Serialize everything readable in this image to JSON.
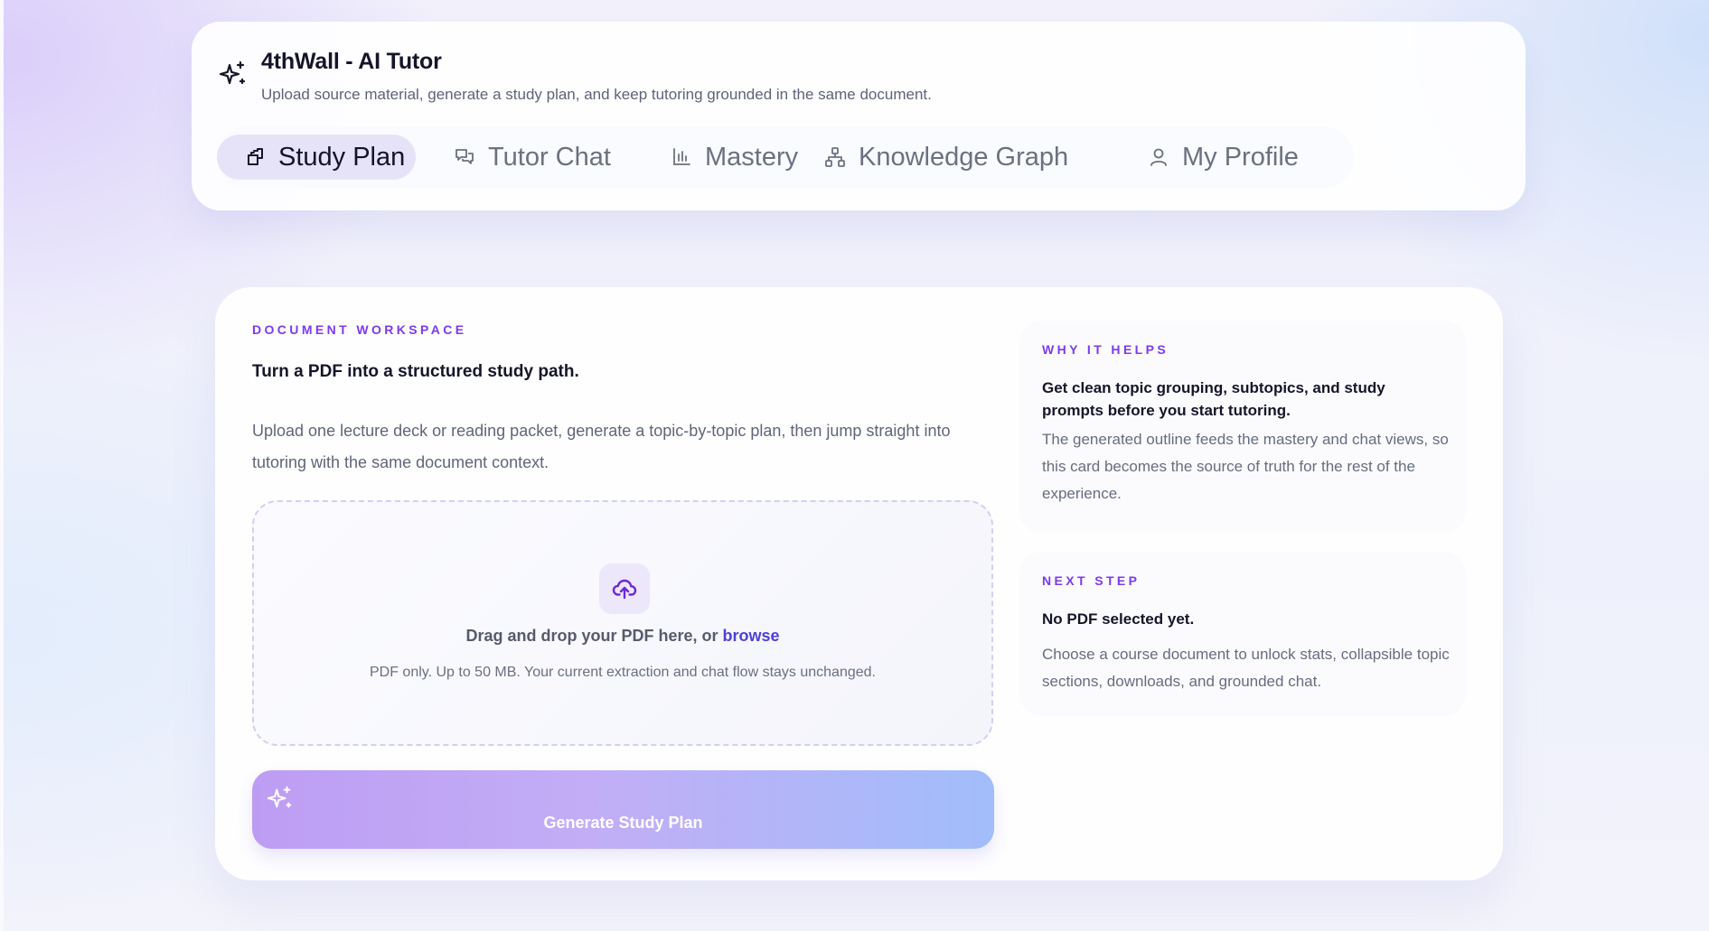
{
  "app": {
    "title": "4thWall - AI Tutor",
    "subtitle": "Upload source material, generate a study plan, and keep tutoring grounded in the same document."
  },
  "nav": {
    "active": "Study Plan",
    "tabs": [
      {
        "label": "Study Plan",
        "icon": "study-plan-icon"
      },
      {
        "label": "Tutor Chat",
        "icon": "chat-icon"
      },
      {
        "label": "Mastery",
        "icon": "bar-chart-icon"
      },
      {
        "label": "Knowledge Graph",
        "icon": "network-icon"
      },
      {
        "label": "My Profile",
        "icon": "user-icon"
      }
    ]
  },
  "workspace": {
    "eyebrow": "DOCUMENT WORKSPACE",
    "title": "Turn a PDF into a structured study path.",
    "description": "Upload one lecture deck or reading packet, generate a topic-by-topic plan, then jump straight into tutoring with the same document context.",
    "dropzone": {
      "prompt": "Drag and drop your PDF here, or ",
      "browse": "browse",
      "hint": "PDF only. Up to 50 MB. Your current extraction and chat flow stays unchanged."
    },
    "generate_label": "Generate Study Plan"
  },
  "why_card": {
    "eyebrow": "WHY IT HELPS",
    "title": "Get clean topic grouping, subtopics, and study prompts before you start tutoring.",
    "description": "The generated outline feeds the mastery and chat views, so this card becomes the source of truth for the rest of the experience."
  },
  "next_card": {
    "eyebrow": "NEXT STEP",
    "title": "No PDF selected yet.",
    "description": "Choose a course document to unlock stats, collapsible topic sections, downloads, and grounded chat."
  },
  "colors": {
    "accent": "#7c3aed",
    "link": "#4c3fd9",
    "active_tab_bg": "#e6e3f9",
    "button_gradient_start": "#bd9df3",
    "button_gradient_end": "#a1bdfa"
  }
}
